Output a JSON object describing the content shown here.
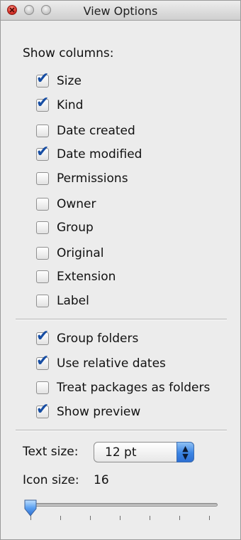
{
  "window": {
    "title": "View Options"
  },
  "show_columns": {
    "heading": "Show columns:",
    "items": [
      {
        "label": "Size",
        "checked": true
      },
      {
        "label": "Kind",
        "checked": true
      },
      {
        "label": "Date created",
        "checked": false
      },
      {
        "label": "Date modified",
        "checked": true
      },
      {
        "label": "Permissions",
        "checked": false
      },
      {
        "label": "Owner",
        "checked": false
      },
      {
        "label": "Group",
        "checked": false
      },
      {
        "label": "Original",
        "checked": false
      },
      {
        "label": "Extension",
        "checked": false
      },
      {
        "label": "Label",
        "checked": false
      }
    ]
  },
  "options": {
    "items": [
      {
        "label": "Group folders",
        "checked": true
      },
      {
        "label": "Use relative dates",
        "checked": true
      },
      {
        "label": "Treat packages as folders",
        "checked": false
      },
      {
        "label": "Show preview",
        "checked": true
      }
    ]
  },
  "text_size": {
    "label": "Text size:",
    "value": "12 pt"
  },
  "icon_size": {
    "label": "Icon size:",
    "value": "16",
    "slider_fraction": 0.0
  },
  "colors": {
    "check_accent": "#164da3",
    "popup_accent": "#3b84e4"
  }
}
